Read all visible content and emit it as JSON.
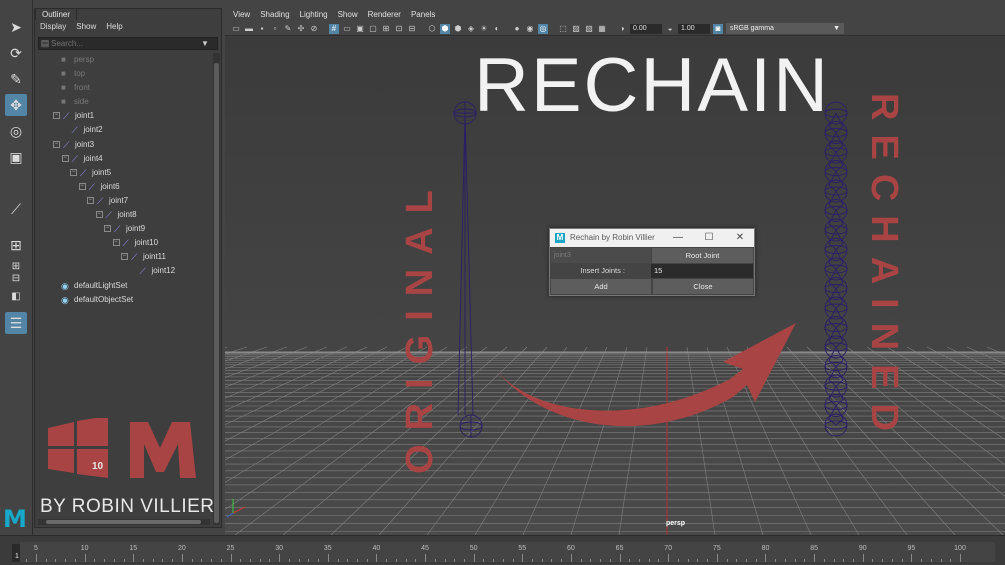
{
  "toolbox": {
    "tools": [
      "select-tool",
      "lasso-tool",
      "paint-tool",
      "move-tool",
      "rotate-tool",
      "scale-tool",
      "joint-tool",
      "layout-single",
      "layout-four",
      "layout-two",
      "outliner-layout"
    ],
    "active_tools": [
      "move-tool",
      "outliner-layout"
    ]
  },
  "outliner": {
    "tab_title": "Outliner",
    "menu": [
      "Display",
      "Show",
      "Help"
    ],
    "search_placeholder": "Search...",
    "items": [
      {
        "label": "persp",
        "depth": 0,
        "kind": "camera",
        "expander": "",
        "dim": true
      },
      {
        "label": "top",
        "depth": 0,
        "kind": "camera",
        "expander": "",
        "dim": true
      },
      {
        "label": "front",
        "depth": 0,
        "kind": "camera",
        "expander": "",
        "dim": true
      },
      {
        "label": "side",
        "depth": 0,
        "kind": "camera",
        "expander": "",
        "dim": true
      },
      {
        "label": "joint1",
        "depth": 0,
        "kind": "joint",
        "expander": "−",
        "dim": false
      },
      {
        "label": "joint2",
        "depth": 1,
        "kind": "joint",
        "expander": "",
        "dim": false
      },
      {
        "label": "joint3",
        "depth": 0,
        "kind": "joint",
        "expander": "−",
        "dim": false
      },
      {
        "label": "joint4",
        "depth": 1,
        "kind": "joint",
        "expander": "−",
        "dim": false
      },
      {
        "label": "joint5",
        "depth": 2,
        "kind": "joint",
        "expander": "−",
        "dim": false
      },
      {
        "label": "joint6",
        "depth": 3,
        "kind": "joint",
        "expander": "−",
        "dim": false
      },
      {
        "label": "joint7",
        "depth": 4,
        "kind": "joint",
        "expander": "−",
        "dim": false
      },
      {
        "label": "joint8",
        "depth": 5,
        "kind": "joint",
        "expander": "−",
        "dim": false
      },
      {
        "label": "joint9",
        "depth": 6,
        "kind": "joint",
        "expander": "−",
        "dim": false
      },
      {
        "label": "joint10",
        "depth": 7,
        "kind": "joint",
        "expander": "−",
        "dim": false
      },
      {
        "label": "joint11",
        "depth": 8,
        "kind": "joint",
        "expander": "−",
        "dim": false
      },
      {
        "label": "joint12",
        "depth": 9,
        "kind": "joint",
        "expander": "",
        "dim": false
      },
      {
        "label": "defaultLightSet",
        "depth": 0,
        "kind": "set",
        "expander": "",
        "dim": false
      },
      {
        "label": "defaultObjectSet",
        "depth": 0,
        "kind": "set",
        "expander": "",
        "dim": false
      }
    ]
  },
  "branding": {
    "windows_version": "10",
    "by_line": "BY ROBIN VILLIER",
    "colors": {
      "brand_red": "#a94444",
      "logo_blue": "#16a9c9"
    }
  },
  "viewport": {
    "menu": [
      "View",
      "Shading",
      "Lighting",
      "Show",
      "Renderer",
      "Panels"
    ],
    "exposure": "0.00",
    "gamma_value": "1.00",
    "color_space": "sRGB gamma",
    "camera_label": "persp",
    "title": "RECHAIN",
    "left_label": "ORIGINAL",
    "right_label": "RECHAINED",
    "original_joint_count": 2,
    "rechained_joint_count": 17
  },
  "dialog": {
    "title": "Rechain by Robin Villier",
    "minimize": "—",
    "maximize": "☐",
    "close": "✕",
    "selected_joint": "joint3",
    "root_joint_button": "Root Joint",
    "insert_label": "Insert Joints :",
    "insert_value": "15",
    "add_button": "Add",
    "close_button": "Close"
  },
  "timeline": {
    "current_frame": "1",
    "ticks": [
      "5",
      "10",
      "15",
      "20",
      "25",
      "30",
      "35",
      "40",
      "45",
      "50",
      "55",
      "60",
      "65",
      "70",
      "75",
      "80",
      "85",
      "90",
      "95",
      "100"
    ]
  }
}
